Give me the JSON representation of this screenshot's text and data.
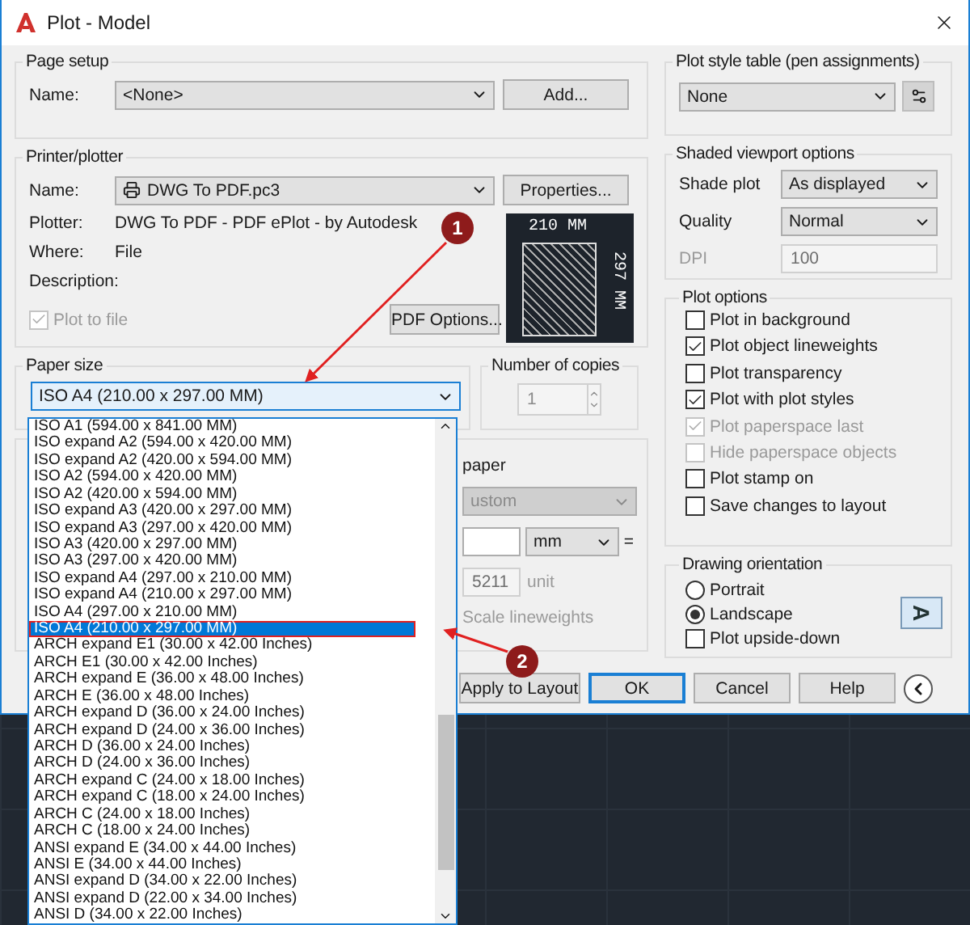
{
  "window": {
    "title": "Plot - Model"
  },
  "page_setup": {
    "title": "Page setup",
    "name_label": "Name:",
    "name_value": "<None>",
    "add_button": "Add..."
  },
  "printer": {
    "title": "Printer/plotter",
    "name_label": "Name:",
    "name_value": "DWG To PDF.pc3",
    "properties_button": "Properties...",
    "info": [
      {
        "label": "Plotter:",
        "value": "DWG To PDF - PDF ePlot - by Autodesk"
      },
      {
        "label": "Where:",
        "value": "File"
      },
      {
        "label": "Description:"
      }
    ],
    "plot_to_file": {
      "label": "Plot to file",
      "checked": true,
      "disabled": true
    },
    "pdf_options_button": "PDF Options...",
    "preview": {
      "width_label": "210 MM",
      "height_label": "297 MM"
    }
  },
  "paper_size": {
    "title": "Paper size",
    "value": "ISO A4 (210.00 x 297.00 MM)",
    "expanded": true,
    "options": [
      {
        "label": "ISO A1 (594.00 x 841.00 MM)",
        "selected": false
      },
      {
        "label": "ISO expand A2 (594.00 x 420.00 MM)",
        "selected": false
      },
      {
        "label": "ISO expand A2 (420.00 x 594.00 MM)",
        "selected": false
      },
      {
        "label": "ISO A2 (594.00 x 420.00 MM)",
        "selected": false
      },
      {
        "label": "ISO A2 (420.00 x 594.00 MM)",
        "selected": false
      },
      {
        "label": "ISO expand A3 (420.00 x 297.00 MM)",
        "selected": false
      },
      {
        "label": "ISO expand A3 (297.00 x 420.00 MM)",
        "selected": false
      },
      {
        "label": "ISO A3 (420.00 x 297.00 MM)",
        "selected": false
      },
      {
        "label": "ISO A3 (297.00 x 420.00 MM)",
        "selected": false
      },
      {
        "label": "ISO expand A4 (297.00 x 210.00 MM)",
        "selected": false
      },
      {
        "label": "ISO expand A4 (210.00 x 297.00 MM)",
        "selected": false
      },
      {
        "label": "ISO A4 (297.00 x 210.00 MM)",
        "selected": false
      },
      {
        "label": "ISO A4 (210.00 x 297.00 MM)",
        "selected": true
      },
      {
        "label": "ARCH expand E1 (30.00 x 42.00 Inches)",
        "selected": false
      },
      {
        "label": "ARCH E1 (30.00 x 42.00 Inches)",
        "selected": false
      },
      {
        "label": "ARCH expand E (36.00 x 48.00 Inches)",
        "selected": false
      },
      {
        "label": "ARCH E (36.00 x 48.00 Inches)",
        "selected": false
      },
      {
        "label": "ARCH expand D (36.00 x 24.00 Inches)",
        "selected": false
      },
      {
        "label": "ARCH expand D (24.00 x 36.00 Inches)",
        "selected": false
      },
      {
        "label": "ARCH D (36.00 x 24.00 Inches)",
        "selected": false
      },
      {
        "label": "ARCH D (24.00 x 36.00 Inches)",
        "selected": false
      },
      {
        "label": "ARCH expand C (24.00 x 18.00 Inches)",
        "selected": false
      },
      {
        "label": "ARCH expand C (18.00 x 24.00 Inches)",
        "selected": false
      },
      {
        "label": "ARCH C (24.00 x 18.00 Inches)",
        "selected": false
      },
      {
        "label": "ARCH C (18.00 x 24.00 Inches)",
        "selected": false
      },
      {
        "label": "ANSI expand E (34.00 x 44.00 Inches)",
        "selected": false
      },
      {
        "label": "ANSI E (34.00 x 44.00 Inches)",
        "selected": false
      },
      {
        "label": "ANSI expand D (34.00 x 22.00 Inches)",
        "selected": false
      },
      {
        "label": "ANSI expand D (22.00 x 34.00 Inches)",
        "selected": false
      },
      {
        "label": "ANSI D (34.00 x 22.00 Inches)",
        "selected": false
      }
    ]
  },
  "copies": {
    "title": "Number of copies",
    "value": "1"
  },
  "plot_scale": {
    "label": "paper",
    "scale_value": "ustom",
    "units_select": "mm",
    "equals": "=",
    "unit_value": "5211",
    "unit_label": "unit",
    "scale_lineweights": "Scale lineweights"
  },
  "buttons": [
    {
      "label": "Apply to Layout",
      "default": false
    },
    {
      "label": "OK",
      "default": true
    },
    {
      "label": "Cancel",
      "default": false
    },
    {
      "label": "Help",
      "default": false
    }
  ],
  "plot_style_table": {
    "title": "Plot style table (pen assignments)",
    "value": "None"
  },
  "shaded_viewport": {
    "title": "Shaded viewport options",
    "rows": [
      {
        "label": "Shade plot",
        "value": "As displayed",
        "kind": "select",
        "disabled": false
      },
      {
        "label": "Quality",
        "value": "Normal",
        "kind": "select",
        "disabled": false
      },
      {
        "label": "DPI",
        "value": "100",
        "kind": "field",
        "disabled": true
      }
    ]
  },
  "plot_options": {
    "title": "Plot options",
    "options": [
      {
        "label": "Plot in background",
        "checked": false,
        "disabled": false
      },
      {
        "label": "Plot object lineweights",
        "checked": true,
        "disabled": false
      },
      {
        "label": "Plot transparency",
        "checked": false,
        "disabled": false
      },
      {
        "label": "Plot with plot styles",
        "checked": true,
        "disabled": false
      },
      {
        "label": "Plot paperspace last",
        "checked": true,
        "disabled": true
      },
      {
        "label": "Hide paperspace objects",
        "checked": false,
        "disabled": true
      },
      {
        "label": "Plot stamp on",
        "checked": false,
        "disabled": false
      },
      {
        "label": "Save changes to layout",
        "checked": false,
        "disabled": false
      }
    ]
  },
  "orientation": {
    "title": "Drawing orientation",
    "options": [
      {
        "label": "Portrait",
        "selected": false
      },
      {
        "label": "Landscape",
        "selected": true
      }
    ],
    "upside_down": {
      "label": "Plot upside-down",
      "checked": false
    },
    "icon_letter": "A"
  },
  "annotations": [
    {
      "number": "1"
    },
    {
      "number": "2"
    }
  ]
}
